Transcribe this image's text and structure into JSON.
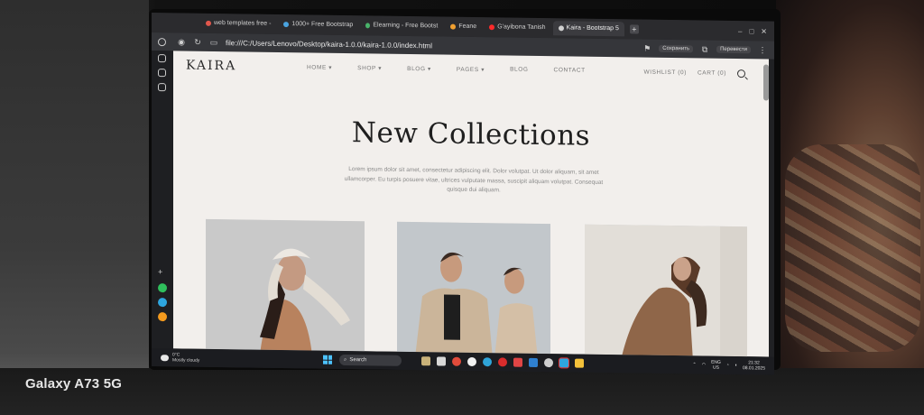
{
  "photo": {
    "device_label": "Galaxy A73 5G"
  },
  "browser": {
    "tabs": [
      {
        "label": "web templates free -",
        "color": "#e2574c",
        "active": false
      },
      {
        "label": "1000+ Free Bootstrap",
        "color": "#4aa3df",
        "active": false
      },
      {
        "label": "Elearning - Free Bootst",
        "color": "#49b36a",
        "active": false
      },
      {
        "label": "Feane",
        "color": "#f0a030",
        "active": false
      },
      {
        "label": "G'ayibona Tanish",
        "color": "#ff2a2a",
        "active": false
      },
      {
        "label": "Kaira - Bootstrap 5",
        "color": "#cfcfcf",
        "active": true
      }
    ],
    "url": "file:///C:/Users/Lenovo/Desktop/kaira-1.0.0/kaira-1.0.0/index.html",
    "save_label": "Сохранить",
    "translate_label": "Перевести"
  },
  "site": {
    "logo": "KAIRA",
    "menu": [
      "HOME ▾",
      "SHOP ▾",
      "BLOG ▾",
      "PAGES ▾",
      "BLOG",
      "CONTACT"
    ],
    "wishlist": "WISHLIST (0)",
    "cart": "CART (0)",
    "hero_title": "New Collections",
    "hero_text": "Lorem ipsum dolor sit amet, consectetur adipiscing elit. Dolor volutpat. Ut dolor aliquam, sit amet ullamcorper. Eu turpis posuere vitae, ultrices vulputate massa, suscipit aliquam volutpat. Consequat quisque dui aliquam."
  },
  "taskbar": {
    "weather": [
      "0°C",
      "Mostly cloudy"
    ],
    "search_label": "Search",
    "tray_lang": [
      "ENG",
      "US"
    ],
    "clock": [
      "21:32",
      "08.01.2025"
    ]
  },
  "colors": {
    "page_bg": "#f2efec",
    "accent_start": "#4cc2ff"
  }
}
